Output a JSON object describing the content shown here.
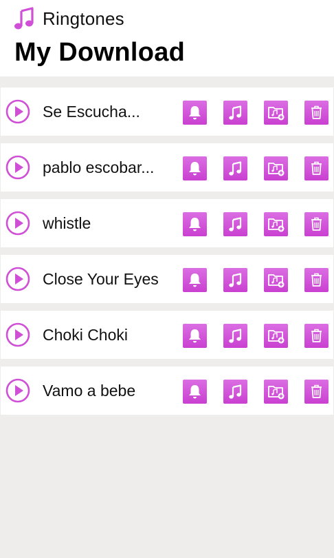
{
  "app": {
    "title": "Ringtones",
    "icon": "music-note-icon",
    "accent_color": "#cf4fd6"
  },
  "page": {
    "title": "My Download"
  },
  "actions": [
    {
      "name": "set-ringtone-button",
      "icon": "bell-icon"
    },
    {
      "name": "set-music-button",
      "icon": "music-note-icon"
    },
    {
      "name": "save-to-folder-button",
      "icon": "folder-add-icon"
    },
    {
      "name": "delete-button",
      "icon": "trash-icon"
    }
  ],
  "downloads": [
    {
      "title": "Se Escucha..."
    },
    {
      "title": "pablo escobar..."
    },
    {
      "title": "whistle"
    },
    {
      "title": "Close Your Eyes"
    },
    {
      "title": "Choki Choki"
    },
    {
      "title": "Vamo a bebe"
    }
  ]
}
